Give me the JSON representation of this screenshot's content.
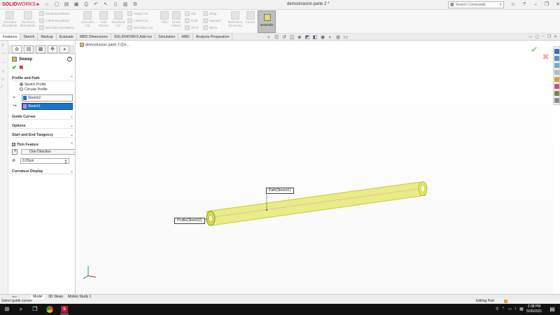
{
  "app": {
    "logo_bold": "SOLID",
    "logo_light": "WORKS",
    "document_title": "demostracion parte 2 *",
    "search_placeholder": "Search Commands",
    "window_controls": {
      "minimize": "–",
      "restore": "❐",
      "close": "✕"
    }
  },
  "ribbon": {
    "big_buttons": [
      {
        "label": "Extruded Boss/Base"
      },
      {
        "label": "Revolved Boss/Base"
      },
      {
        "label": "Extruded Cut"
      },
      {
        "label": "Hole Wizard"
      },
      {
        "label": "Revolved Cut"
      },
      {
        "label": "Fillet"
      },
      {
        "label": "Linear Pattern"
      },
      {
        "label": "Reference Geometry"
      },
      {
        "label": "Curves"
      }
    ],
    "small_buttons": [
      {
        "label": "Swept Boss/Base"
      },
      {
        "label": "Lofted Boss/Base"
      },
      {
        "label": "Boundary Boss/Base"
      },
      {
        "label": "Swept Cut"
      },
      {
        "label": "Lofted Cut"
      },
      {
        "label": "Boundary Cut"
      },
      {
        "label": "Rib"
      },
      {
        "label": "Draft"
      },
      {
        "label": "Shell"
      },
      {
        "label": "Wrap"
      },
      {
        "label": "Intersect"
      },
      {
        "label": "Mirror"
      }
    ],
    "instant3d": "Instant3D"
  },
  "tabs": [
    "Features",
    "Sketch",
    "Markup",
    "Evaluate",
    "MBD Dimensions",
    "SOLIDWORKS Add-Ins",
    "Simulation",
    "MBD",
    "Analysis Preparation"
  ],
  "property_manager": {
    "title": "Sweep",
    "help": "?",
    "ok": "✔",
    "cancel": "✖",
    "profile_and_path": "Profile and Path",
    "sketch_profile": "Sketch Profile",
    "circular_profile": "Circular Profile",
    "profile_value": "Sketch2",
    "path_value": "Sketch1",
    "guide_curves": "Guide Curves",
    "options": "Options",
    "start_end_tangency": "Start and End Tangency",
    "thin_feature": "Thin Feature",
    "thin_type": "One-Direction",
    "thin_thickness": "0.20cm",
    "curvature_display": "Curvature Display",
    "chevron_down": "⌄",
    "chevron_up": "⌃",
    "check": "✓"
  },
  "viewport": {
    "breadcrumb": "demostracion parte 2  (De...",
    "path_callout": "Path(Sketch1)",
    "profile_callout": "Profile(Sketch2)"
  },
  "bottom_tabs": [
    "Model",
    "3D Views",
    "Motion Study 1"
  ],
  "status": {
    "left": "Select guide curves",
    "right": "Editing Part"
  },
  "taskbar": {
    "time": "2:38 PM",
    "date": "5/26/2021"
  },
  "colors": {
    "tube_fill": "#e9ec88",
    "tube_outline": "#c7cc2a",
    "selection_blue": "#1874cd",
    "ok_green": "#2a9d2a",
    "cancel_red": "#c62828"
  }
}
